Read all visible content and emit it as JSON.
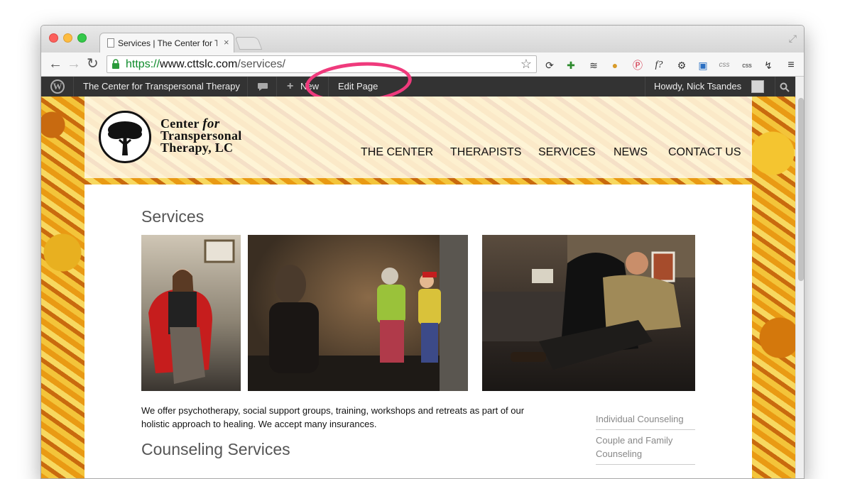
{
  "browser": {
    "tab_title": "Services | The Center for T",
    "tab_close": "×",
    "url_scheme": "https://",
    "url_host": "www.cttslc.com",
    "url_path": "/services/",
    "star_icon": "☆",
    "extensions_text": [
      "f?",
      "css",
      "css"
    ]
  },
  "admin_bar": {
    "site_name": "The Center for Transpersonal Therapy",
    "new_label": "New",
    "new_icon": "+",
    "edit_label": "Edit Page",
    "howdy": "Howdy, Nick Tsandes",
    "comment_icon": "speech-bubble-icon",
    "search_icon": "search-icon"
  },
  "site": {
    "logo_line1_a": "Center",
    "logo_line1_b": "for",
    "logo_line2": "Transpersonal",
    "logo_line3": "Therapy, LC",
    "nav": [
      "THE CENTER",
      "THERAPISTS",
      "SERVICES",
      "NEWS",
      "CONTACT US"
    ]
  },
  "main": {
    "title": "Services",
    "intro": "We offer psychotherapy, social support groups, training, workshops and retreats as part of our holistic approach to healing. We accept many insurances.",
    "section_heading": "Counseling Services"
  },
  "sidebar": {
    "links": [
      "Individual Counseling",
      "Couple and Family Counseling"
    ]
  },
  "colors": {
    "admin_bar": "#333333",
    "highlight": "#ef3a7c",
    "url_green": "#0c8b2a"
  }
}
